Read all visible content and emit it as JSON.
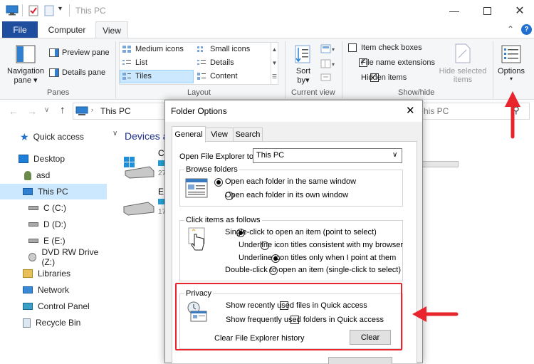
{
  "window": {
    "title": "This PC"
  },
  "tabs": {
    "file": "File",
    "computer": "Computer",
    "view": "View"
  },
  "ribbon": {
    "panes": {
      "navigation_pane": "Navigation",
      "navigation_pane_2": "pane",
      "preview_pane": "Preview pane",
      "details_pane": "Details pane",
      "label": "Panes"
    },
    "layout": {
      "medium_icons": "Medium icons",
      "small_icons": "Small icons",
      "list": "List",
      "details": "Details",
      "tiles": "Tiles",
      "content": "Content",
      "label": "Layout"
    },
    "current_view": {
      "sort_by": "Sort",
      "sort_by_2": "by",
      "label": "Current view"
    },
    "show_hide": {
      "item_check_boxes": "Item check boxes",
      "item_check_boxes_checked": false,
      "file_name_extensions": "File name extensions",
      "file_name_extensions_checked": true,
      "hidden_items": "Hidden items",
      "hidden_items_checked": true,
      "hide_selected": "Hide selected",
      "hide_selected_2": "items",
      "label": "Show/hide"
    },
    "options": "Options"
  },
  "address": {
    "path": "This PC",
    "search_tail": "his PC"
  },
  "nav": {
    "items": [
      {
        "label": "Quick access"
      },
      {
        "label": "Desktop"
      },
      {
        "label": "asd"
      },
      {
        "label": "This PC"
      },
      {
        "label": "C (C:)"
      },
      {
        "label": "D (D:)"
      },
      {
        "label": "E (E:)"
      },
      {
        "label": "DVD RW Drive (Z:)"
      },
      {
        "label": "Libraries"
      },
      {
        "label": "Network"
      },
      {
        "label": "Control Panel"
      },
      {
        "label": "Recycle Bin"
      }
    ]
  },
  "content": {
    "group_header": "Devices a",
    "drives": [
      {
        "letter": "C",
        "sub": "27"
      },
      {
        "letter": "E",
        "sub": "17"
      }
    ]
  },
  "dialog": {
    "title": "Folder Options",
    "tabs": [
      "General",
      "View",
      "Search"
    ],
    "open_to_label": "Open File Explorer to:",
    "open_to_value": "This PC",
    "browse": {
      "label": "Browse folders",
      "same_window": "Open each folder in the same window",
      "own_window": "Open each folder in its own window"
    },
    "click": {
      "label": "Click items as follows",
      "single": "Single-click to open an item (point to select)",
      "underline_consistent": "Underline icon titles consistent with my browser",
      "underline_point": "Underline icon titles only when I point at them",
      "double": "Double-click to open an item (single-click to select)"
    },
    "privacy": {
      "label": "Privacy",
      "recent_files": "Show recently used files in Quick access",
      "frequent_folders": "Show frequently used folders in Quick access",
      "clear_history": "Clear File Explorer history",
      "clear_button": "Clear"
    }
  },
  "colors": {
    "accent": "#1f4e9e",
    "annotation": "#e8242d",
    "selection": "#cce8ff"
  }
}
